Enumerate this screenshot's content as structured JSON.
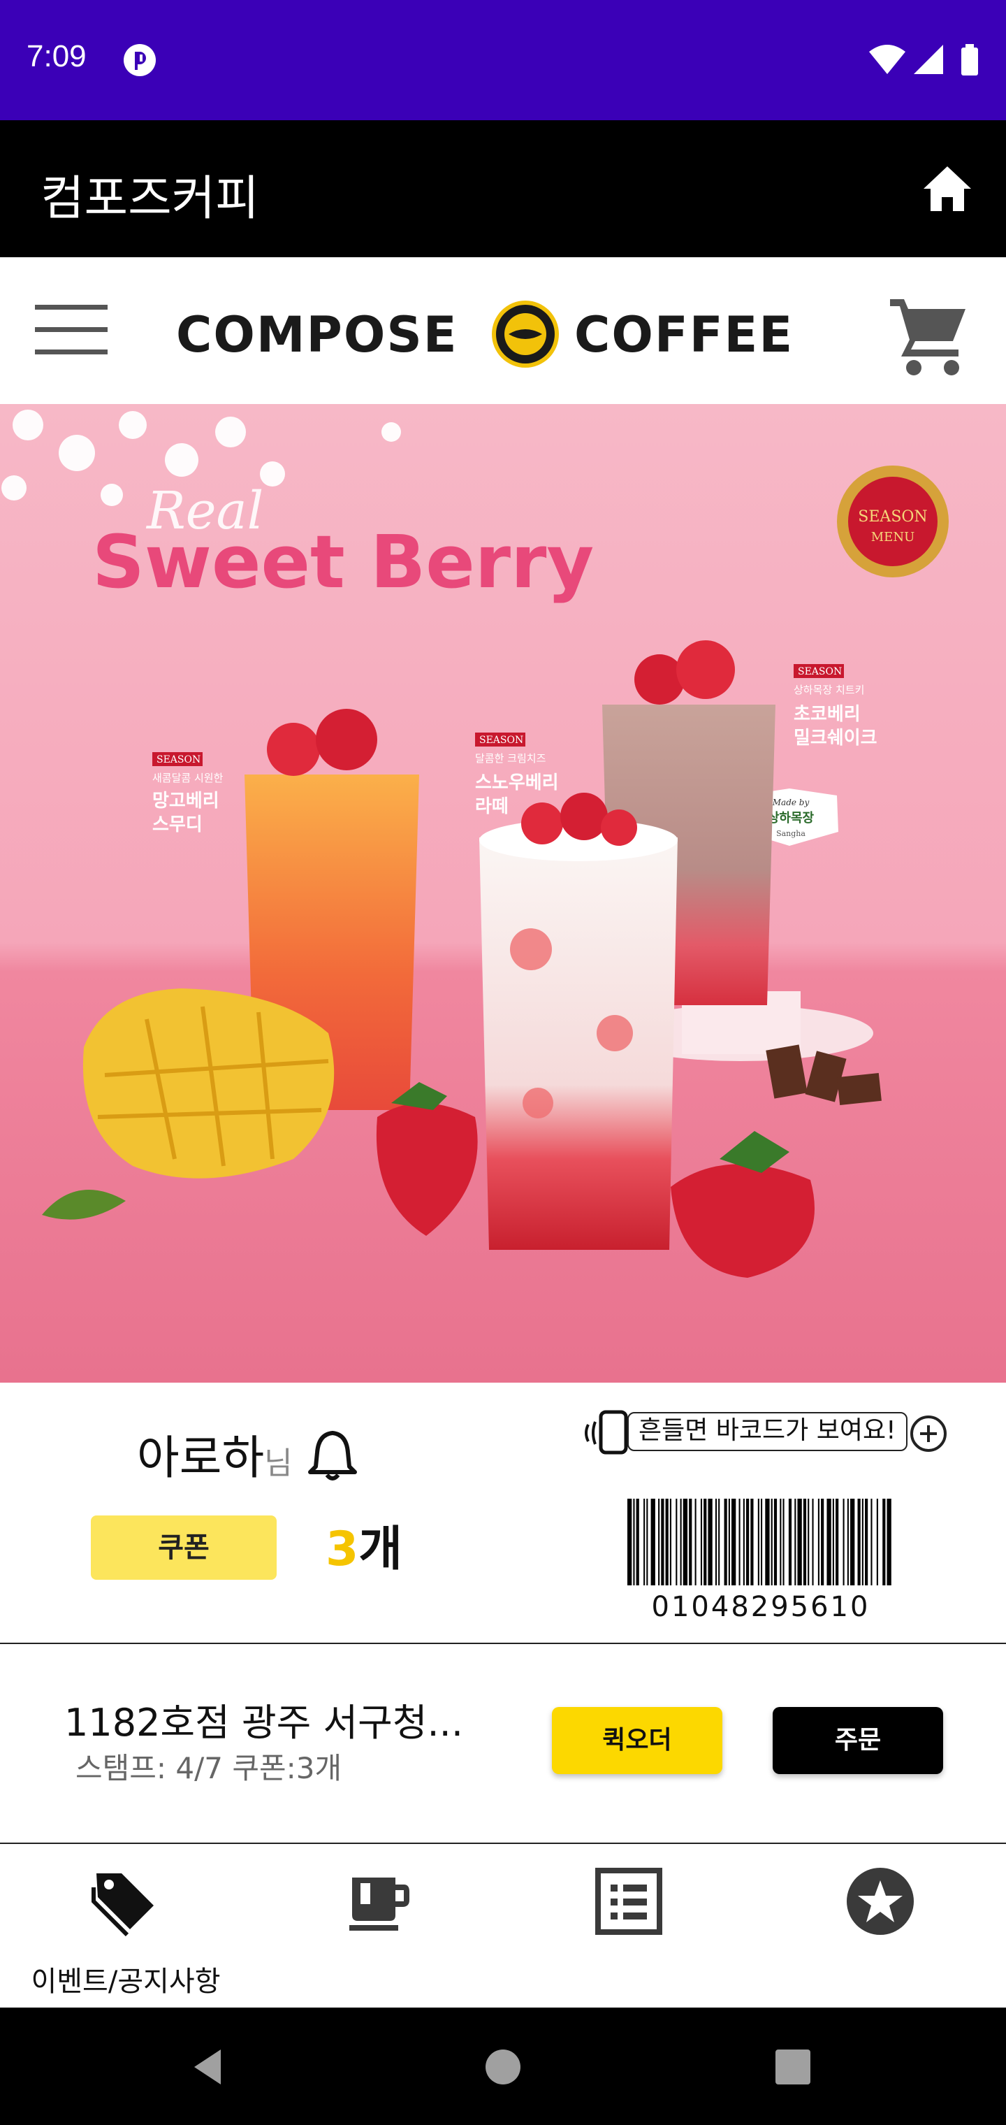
{
  "status_bar": {
    "time": "7:09",
    "background": "#3b00b7",
    "icons": [
      "app-notification-icon",
      "wifi-icon",
      "signal-icon",
      "battery-icon"
    ]
  },
  "app_bar": {
    "title": "컴포즈커피",
    "home_icon": "home-icon"
  },
  "web_header": {
    "menu_icon": "hamburger-menu-icon",
    "logo_left": "COMPOSE",
    "logo_right": "COFFEE",
    "emblem_top": "COMPOSE",
    "emblem_bottom": "COFFEE",
    "cart_icon": "shopping-cart-icon"
  },
  "banner": {
    "script_title": "Real",
    "title": "Sweet Berry",
    "season_badge_top": "SEASON",
    "season_badge_bottom": "MENU",
    "products": [
      {
        "tag": "SEASON",
        "subtitle": "새콤달콤 시원한",
        "name_line1": "망고베리",
        "name_line2": "스무디"
      },
      {
        "tag": "SEASON",
        "subtitle": "달콤한 크림치즈",
        "name_line1": "스노우베리",
        "name_line2": "라떼"
      },
      {
        "tag": "SEASON",
        "subtitle": "상하목장 치트키",
        "name_line1": "초코베리",
        "name_line2": "밀크쉐이크"
      }
    ],
    "made_by_line1": "Made by",
    "made_by_line2": "상하목장",
    "made_by_line3": "Sangha"
  },
  "user_panel": {
    "name": "아로하",
    "suffix": "님",
    "coupon_label": "쿠폰",
    "coupon_count": "3",
    "coupon_unit": "개",
    "shake_hint": "흔들면 바코드가 보여요!",
    "barcode_number": "01048295610"
  },
  "store_panel": {
    "store_name": "1182호점 광주 서구청...",
    "stamp_info": "스탬프: 4/7 쿠폰:3개",
    "quick_order_label": "퀵오더",
    "order_label": "주문",
    "accent_color": "#fcd800"
  },
  "bottom_nav": {
    "items": [
      {
        "label": "이벤트/공지사항",
        "icon": "tags-icon",
        "active": true
      },
      {
        "label": "",
        "icon": "coffee-cup-icon",
        "active": false
      },
      {
        "label": "",
        "icon": "list-icon",
        "active": false
      },
      {
        "label": "",
        "icon": "star-icon",
        "active": false
      }
    ]
  },
  "system_nav": {
    "buttons": [
      "back-icon",
      "home-circle-icon",
      "recents-icon"
    ]
  }
}
